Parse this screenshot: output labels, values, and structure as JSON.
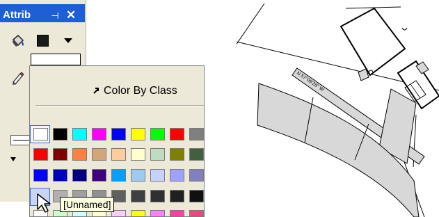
{
  "panel": {
    "title": "Attrib",
    "pin_glyph": "⊣",
    "close_glyph": "✕",
    "fill_icon": "paint-bucket-icon",
    "line_icon": "pencil-icon",
    "fill_color": "#1a1a1a"
  },
  "picker": {
    "color_by_class_label": "Color By Class",
    "tooltip": "[Unnamed]",
    "swatch_rows": [
      [
        "#ffffff",
        "#000000",
        "#00ffff",
        "#ff00ff",
        "#0000ff",
        "#ffff00",
        "#00ff00",
        "#ff0000",
        "#7f7f7f"
      ],
      [
        "#ff0000",
        "#800000",
        "#ff7f40",
        "#d2a679",
        "#ffcc99",
        "#ffffcc",
        "#c0dcc0",
        "#808000",
        "#406040"
      ],
      [
        "#0000ff",
        "#0000c0",
        "#000080",
        "#400080",
        "#00a0ff",
        "#a0c8f0",
        "#c8d0ff",
        "#a0a0ff",
        "#8080c0"
      ],
      [
        "#d0d0d0",
        "#b0b0b0",
        "#a0a0a0",
        "#909090",
        "#606060",
        "#404040",
        "#303030",
        "#202020",
        "#101010"
      ],
      [
        "#ffffff",
        "#ccffcc",
        "#ccffff",
        "#ffffcc",
        "#ffccff",
        "#ffff00",
        "#ff80ff",
        "#ff40a0",
        "#ff4080"
      ]
    ]
  },
  "map": {
    "bearing_label": "N 57°09'28\" W"
  }
}
